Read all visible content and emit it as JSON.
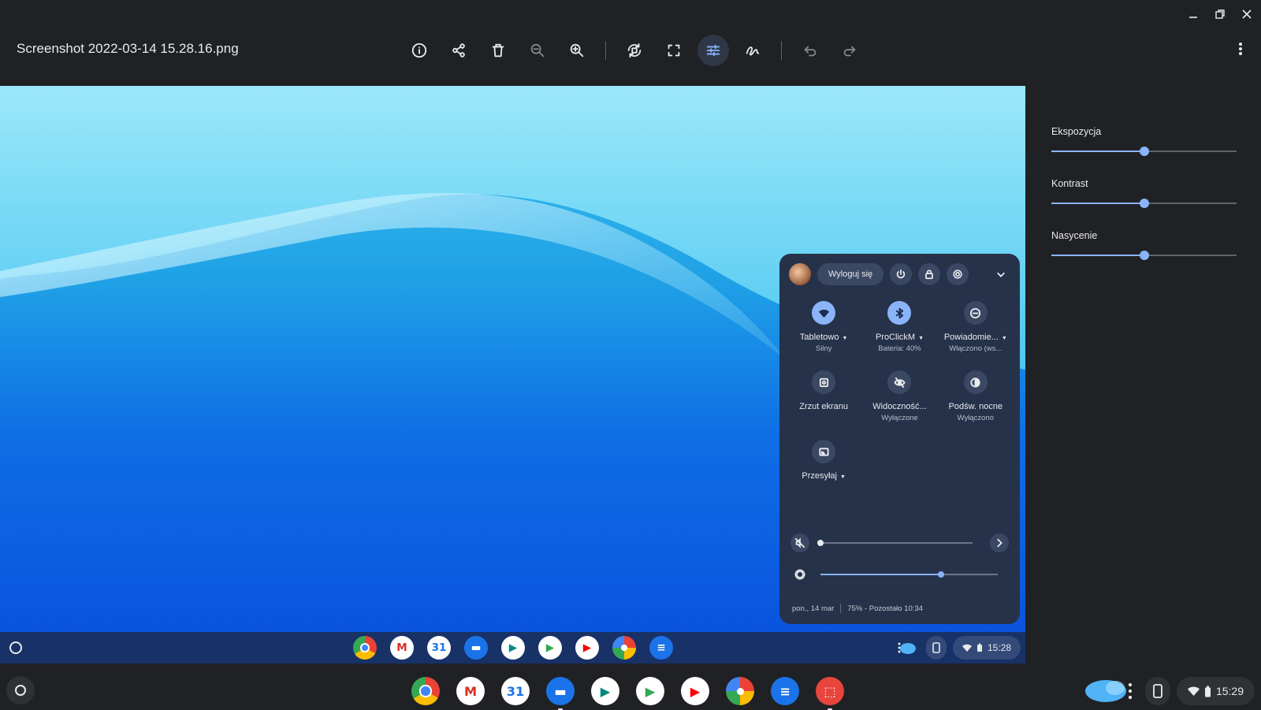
{
  "window": {
    "title": "Screenshot 2022-03-14 15.28.16.png",
    "controls": [
      "minimize-icon",
      "restore-icon",
      "close-icon"
    ]
  },
  "toolbar": {
    "buttons": [
      "info-icon",
      "share-icon",
      "delete-icon",
      "zoom-out-icon",
      "zoom-in-icon",
      "rotate-icon",
      "crop-icon",
      "adjust-icon",
      "annotate-icon",
      "undo-icon",
      "redo-icon"
    ],
    "active": "adjust-icon",
    "more": "more-vert-icon"
  },
  "adjustments": {
    "exposure": {
      "label": "Ekspozycja",
      "value": 0.5
    },
    "contrast": {
      "label": "Kontrast",
      "value": 0.5
    },
    "saturation": {
      "label": "Nasycenie",
      "value": 0.5
    }
  },
  "quick_settings": {
    "signout_label": "Wyloguj się",
    "tiles": [
      {
        "label": "Tabletowo",
        "sub": "Silny",
        "icon": "wifi-icon",
        "on": true,
        "caret": true
      },
      {
        "label": "ProClickM",
        "sub": "Bateria: 40%",
        "icon": "bluetooth-icon",
        "on": true,
        "caret": true
      },
      {
        "label": "Powiadomie...",
        "sub": "Włączono (ws...",
        "icon": "do-not-disturb-icon",
        "on": false,
        "caret": true
      },
      {
        "label": "Zrzut ekranu",
        "sub": "",
        "icon": "screen-capture-icon",
        "on": false,
        "caret": false
      },
      {
        "label": "Widoczność...",
        "sub": "Wyłączone",
        "icon": "visibility-off-icon",
        "on": false,
        "caret": false
      },
      {
        "label": "Podśw. nocne",
        "sub": "Wyłączono",
        "icon": "night-light-icon",
        "on": false,
        "caret": false
      },
      {
        "label": "Przesyłaj",
        "sub": "",
        "icon": "cast-icon",
        "on": false,
        "caret": true
      }
    ],
    "volume": {
      "level": 0.0,
      "icon": "volume-muted-icon"
    },
    "brightness": {
      "level": 0.68,
      "icon": "brightness-icon"
    },
    "footer_date": "pon., 14 mar",
    "footer_battery": "75% - Pozostało 10:34"
  },
  "inner_shelf": {
    "time": "15:28",
    "apps": [
      "chrome",
      "gmail",
      "calendar",
      "files",
      "meet",
      "play-store",
      "youtube",
      "photos",
      "messages"
    ]
  },
  "shelf": {
    "time": "15:29",
    "apps": [
      "chrome",
      "gmail",
      "calendar",
      "files",
      "meet",
      "play-store",
      "youtube",
      "photos",
      "messages",
      "screenshot-app"
    ]
  },
  "colors": {
    "accent": "#8ab4f8",
    "background": "#202124",
    "quick_settings_bg": "#26324a"
  }
}
